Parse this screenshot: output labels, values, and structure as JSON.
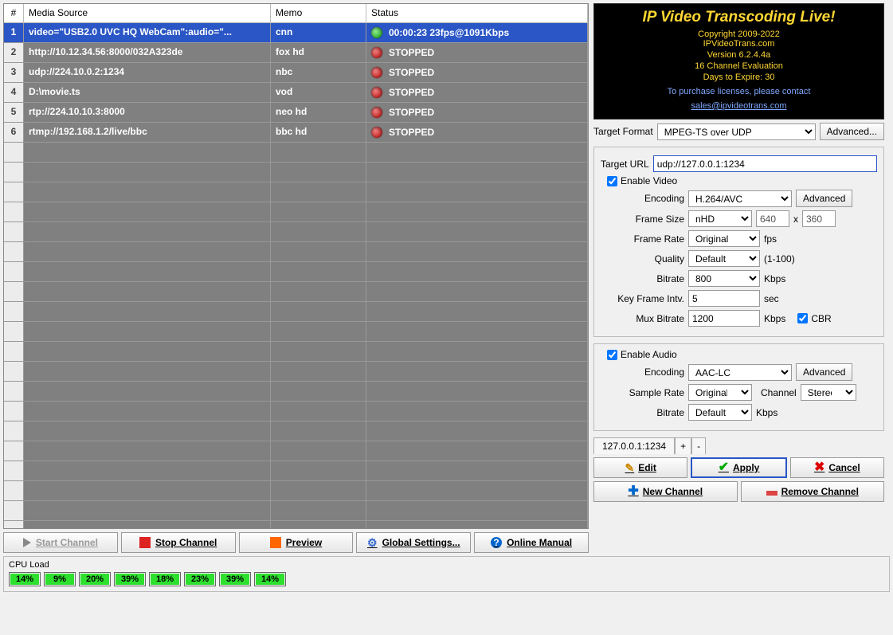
{
  "table": {
    "headers": {
      "num": "#",
      "source": "Media Source",
      "memo": "Memo",
      "status": "Status"
    },
    "rows": [
      {
        "n": "1",
        "src": "video=\"USB2.0 UVC HQ WebCam\":audio=\"...",
        "memo": "cnn",
        "status": "00:00:23   23fps@1091Kbps",
        "led": "green",
        "selected": true
      },
      {
        "n": "2",
        "src": "http://10.12.34.56:8000/032A323de",
        "memo": "fox hd",
        "status": "STOPPED",
        "led": "red"
      },
      {
        "n": "3",
        "src": "udp://224.10.0.2:1234",
        "memo": "nbc",
        "status": "STOPPED",
        "led": "red"
      },
      {
        "n": "4",
        "src": "D:\\movie.ts",
        "memo": "vod",
        "status": "STOPPED",
        "led": "red"
      },
      {
        "n": "5",
        "src": "rtp://224.10.10.3:8000",
        "memo": "neo hd",
        "status": "STOPPED",
        "led": "red"
      },
      {
        "n": "6",
        "src": "rtmp://192.168.1.2/live/bbc",
        "memo": "bbc hd",
        "status": "STOPPED",
        "led": "red"
      }
    ]
  },
  "banner": {
    "title": "IP Video Transcoding Live!",
    "copyright": "Copyright 2009-2022",
    "site": "IPVideoTrans.com",
    "version": "Version 6.2.4.4a",
    "eval": "16 Channel Evaluation",
    "expire": "Days to Expire: 30",
    "contact": "To purchase licenses, please contact",
    "email": "sales@ipvideotrans.com"
  },
  "target": {
    "formatLabel": "Target Format",
    "formatValue": "MPEG-TS over UDP",
    "advanced": "Advanced...",
    "urlLabel": "Target URL",
    "urlValue": "udp://127.0.0.1:1234"
  },
  "video": {
    "enable": "Enable Video",
    "encodingLabel": "Encoding",
    "encodingValue": "H.264/AVC",
    "advanced": "Advanced",
    "frameSizeLabel": "Frame Size",
    "frameSizeValue": "nHD",
    "w": "640",
    "h": "360",
    "x": "x",
    "frameRateLabel": "Frame Rate",
    "frameRateValue": "Original",
    "fps": "fps",
    "qualityLabel": "Quality",
    "qualityValue": "Default",
    "qualityHint": "(1-100)",
    "bitrateLabel": "Bitrate",
    "bitrateValue": "800",
    "kbps": "Kbps",
    "keyLabel": "Key Frame Intv.",
    "keyValue": "5",
    "sec": "sec",
    "muxLabel": "Mux Bitrate",
    "muxValue": "1200",
    "cbr": "CBR"
  },
  "audio": {
    "enable": "Enable Audio",
    "encodingLabel": "Encoding",
    "encodingValue": "AAC-LC",
    "advanced": "Advanced",
    "sampleLabel": "Sample Rate",
    "sampleValue": "Original",
    "channelLabel": "Channel",
    "channelValue": "Stereo",
    "bitrateLabel": "Bitrate",
    "bitrateValue": "Default",
    "kbps": "Kbps"
  },
  "tabs": {
    "addr": "127.0.0.1:1234",
    "plus": "+",
    "minus": "-"
  },
  "actions": {
    "edit": "Edit",
    "apply": "Apply",
    "cancel": "Cancel",
    "newch": "New Channel",
    "removech": "Remove Channel"
  },
  "toolbar": {
    "start": "Start Channel",
    "stop": "Stop Channel",
    "preview": "Preview",
    "global": "Global Settings...",
    "manual": "Online Manual"
  },
  "cpu": {
    "label": "CPU Load",
    "cores": [
      "14%",
      "9%",
      "20%",
      "39%",
      "18%",
      "23%",
      "39%",
      "14%"
    ]
  }
}
